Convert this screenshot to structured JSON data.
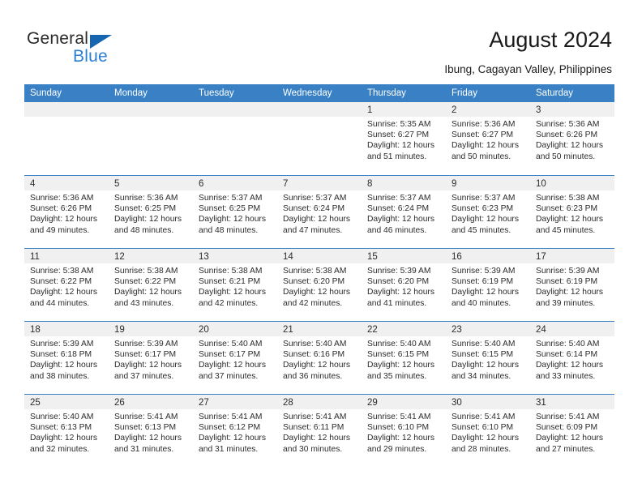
{
  "brand": {
    "name_part1": "General",
    "name_part2": "Blue",
    "triangle_color": "#1565b0",
    "blue_color": "#2b7fd4"
  },
  "header": {
    "title": "August 2024",
    "subtitle": "Ibung, Cagayan Valley, Philippines"
  },
  "theme": {
    "header_blue": "#3a80c4",
    "day_band_grey": "#f0f0f0",
    "text_color": "#2b2b2b"
  },
  "calendar": {
    "weekdays": [
      "Sunday",
      "Monday",
      "Tuesday",
      "Wednesday",
      "Thursday",
      "Friday",
      "Saturday"
    ],
    "weeks": [
      [
        {
          "day": "",
          "sunrise": "",
          "sunset": "",
          "daylight_line1": "",
          "daylight_line2": ""
        },
        {
          "day": "",
          "sunrise": "",
          "sunset": "",
          "daylight_line1": "",
          "daylight_line2": ""
        },
        {
          "day": "",
          "sunrise": "",
          "sunset": "",
          "daylight_line1": "",
          "daylight_line2": ""
        },
        {
          "day": "",
          "sunrise": "",
          "sunset": "",
          "daylight_line1": "",
          "daylight_line2": ""
        },
        {
          "day": "1",
          "sunrise": "Sunrise: 5:35 AM",
          "sunset": "Sunset: 6:27 PM",
          "daylight_line1": "Daylight: 12 hours",
          "daylight_line2": "and 51 minutes."
        },
        {
          "day": "2",
          "sunrise": "Sunrise: 5:36 AM",
          "sunset": "Sunset: 6:27 PM",
          "daylight_line1": "Daylight: 12 hours",
          "daylight_line2": "and 50 minutes."
        },
        {
          "day": "3",
          "sunrise": "Sunrise: 5:36 AM",
          "sunset": "Sunset: 6:26 PM",
          "daylight_line1": "Daylight: 12 hours",
          "daylight_line2": "and 50 minutes."
        }
      ],
      [
        {
          "day": "4",
          "sunrise": "Sunrise: 5:36 AM",
          "sunset": "Sunset: 6:26 PM",
          "daylight_line1": "Daylight: 12 hours",
          "daylight_line2": "and 49 minutes."
        },
        {
          "day": "5",
          "sunrise": "Sunrise: 5:36 AM",
          "sunset": "Sunset: 6:25 PM",
          "daylight_line1": "Daylight: 12 hours",
          "daylight_line2": "and 48 minutes."
        },
        {
          "day": "6",
          "sunrise": "Sunrise: 5:37 AM",
          "sunset": "Sunset: 6:25 PM",
          "daylight_line1": "Daylight: 12 hours",
          "daylight_line2": "and 48 minutes."
        },
        {
          "day": "7",
          "sunrise": "Sunrise: 5:37 AM",
          "sunset": "Sunset: 6:24 PM",
          "daylight_line1": "Daylight: 12 hours",
          "daylight_line2": "and 47 minutes."
        },
        {
          "day": "8",
          "sunrise": "Sunrise: 5:37 AM",
          "sunset": "Sunset: 6:24 PM",
          "daylight_line1": "Daylight: 12 hours",
          "daylight_line2": "and 46 minutes."
        },
        {
          "day": "9",
          "sunrise": "Sunrise: 5:37 AM",
          "sunset": "Sunset: 6:23 PM",
          "daylight_line1": "Daylight: 12 hours",
          "daylight_line2": "and 45 minutes."
        },
        {
          "day": "10",
          "sunrise": "Sunrise: 5:38 AM",
          "sunset": "Sunset: 6:23 PM",
          "daylight_line1": "Daylight: 12 hours",
          "daylight_line2": "and 45 minutes."
        }
      ],
      [
        {
          "day": "11",
          "sunrise": "Sunrise: 5:38 AM",
          "sunset": "Sunset: 6:22 PM",
          "daylight_line1": "Daylight: 12 hours",
          "daylight_line2": "and 44 minutes."
        },
        {
          "day": "12",
          "sunrise": "Sunrise: 5:38 AM",
          "sunset": "Sunset: 6:22 PM",
          "daylight_line1": "Daylight: 12 hours",
          "daylight_line2": "and 43 minutes."
        },
        {
          "day": "13",
          "sunrise": "Sunrise: 5:38 AM",
          "sunset": "Sunset: 6:21 PM",
          "daylight_line1": "Daylight: 12 hours",
          "daylight_line2": "and 42 minutes."
        },
        {
          "day": "14",
          "sunrise": "Sunrise: 5:38 AM",
          "sunset": "Sunset: 6:20 PM",
          "daylight_line1": "Daylight: 12 hours",
          "daylight_line2": "and 42 minutes."
        },
        {
          "day": "15",
          "sunrise": "Sunrise: 5:39 AM",
          "sunset": "Sunset: 6:20 PM",
          "daylight_line1": "Daylight: 12 hours",
          "daylight_line2": "and 41 minutes."
        },
        {
          "day": "16",
          "sunrise": "Sunrise: 5:39 AM",
          "sunset": "Sunset: 6:19 PM",
          "daylight_line1": "Daylight: 12 hours",
          "daylight_line2": "and 40 minutes."
        },
        {
          "day": "17",
          "sunrise": "Sunrise: 5:39 AM",
          "sunset": "Sunset: 6:19 PM",
          "daylight_line1": "Daylight: 12 hours",
          "daylight_line2": "and 39 minutes."
        }
      ],
      [
        {
          "day": "18",
          "sunrise": "Sunrise: 5:39 AM",
          "sunset": "Sunset: 6:18 PM",
          "daylight_line1": "Daylight: 12 hours",
          "daylight_line2": "and 38 minutes."
        },
        {
          "day": "19",
          "sunrise": "Sunrise: 5:39 AM",
          "sunset": "Sunset: 6:17 PM",
          "daylight_line1": "Daylight: 12 hours",
          "daylight_line2": "and 37 minutes."
        },
        {
          "day": "20",
          "sunrise": "Sunrise: 5:40 AM",
          "sunset": "Sunset: 6:17 PM",
          "daylight_line1": "Daylight: 12 hours",
          "daylight_line2": "and 37 minutes."
        },
        {
          "day": "21",
          "sunrise": "Sunrise: 5:40 AM",
          "sunset": "Sunset: 6:16 PM",
          "daylight_line1": "Daylight: 12 hours",
          "daylight_line2": "and 36 minutes."
        },
        {
          "day": "22",
          "sunrise": "Sunrise: 5:40 AM",
          "sunset": "Sunset: 6:15 PM",
          "daylight_line1": "Daylight: 12 hours",
          "daylight_line2": "and 35 minutes."
        },
        {
          "day": "23",
          "sunrise": "Sunrise: 5:40 AM",
          "sunset": "Sunset: 6:15 PM",
          "daylight_line1": "Daylight: 12 hours",
          "daylight_line2": "and 34 minutes."
        },
        {
          "day": "24",
          "sunrise": "Sunrise: 5:40 AM",
          "sunset": "Sunset: 6:14 PM",
          "daylight_line1": "Daylight: 12 hours",
          "daylight_line2": "and 33 minutes."
        }
      ],
      [
        {
          "day": "25",
          "sunrise": "Sunrise: 5:40 AM",
          "sunset": "Sunset: 6:13 PM",
          "daylight_line1": "Daylight: 12 hours",
          "daylight_line2": "and 32 minutes."
        },
        {
          "day": "26",
          "sunrise": "Sunrise: 5:41 AM",
          "sunset": "Sunset: 6:13 PM",
          "daylight_line1": "Daylight: 12 hours",
          "daylight_line2": "and 31 minutes."
        },
        {
          "day": "27",
          "sunrise": "Sunrise: 5:41 AM",
          "sunset": "Sunset: 6:12 PM",
          "daylight_line1": "Daylight: 12 hours",
          "daylight_line2": "and 31 minutes."
        },
        {
          "day": "28",
          "sunrise": "Sunrise: 5:41 AM",
          "sunset": "Sunset: 6:11 PM",
          "daylight_line1": "Daylight: 12 hours",
          "daylight_line2": "and 30 minutes."
        },
        {
          "day": "29",
          "sunrise": "Sunrise: 5:41 AM",
          "sunset": "Sunset: 6:10 PM",
          "daylight_line1": "Daylight: 12 hours",
          "daylight_line2": "and 29 minutes."
        },
        {
          "day": "30",
          "sunrise": "Sunrise: 5:41 AM",
          "sunset": "Sunset: 6:10 PM",
          "daylight_line1": "Daylight: 12 hours",
          "daylight_line2": "and 28 minutes."
        },
        {
          "day": "31",
          "sunrise": "Sunrise: 5:41 AM",
          "sunset": "Sunset: 6:09 PM",
          "daylight_line1": "Daylight: 12 hours",
          "daylight_line2": "and 27 minutes."
        }
      ]
    ]
  }
}
